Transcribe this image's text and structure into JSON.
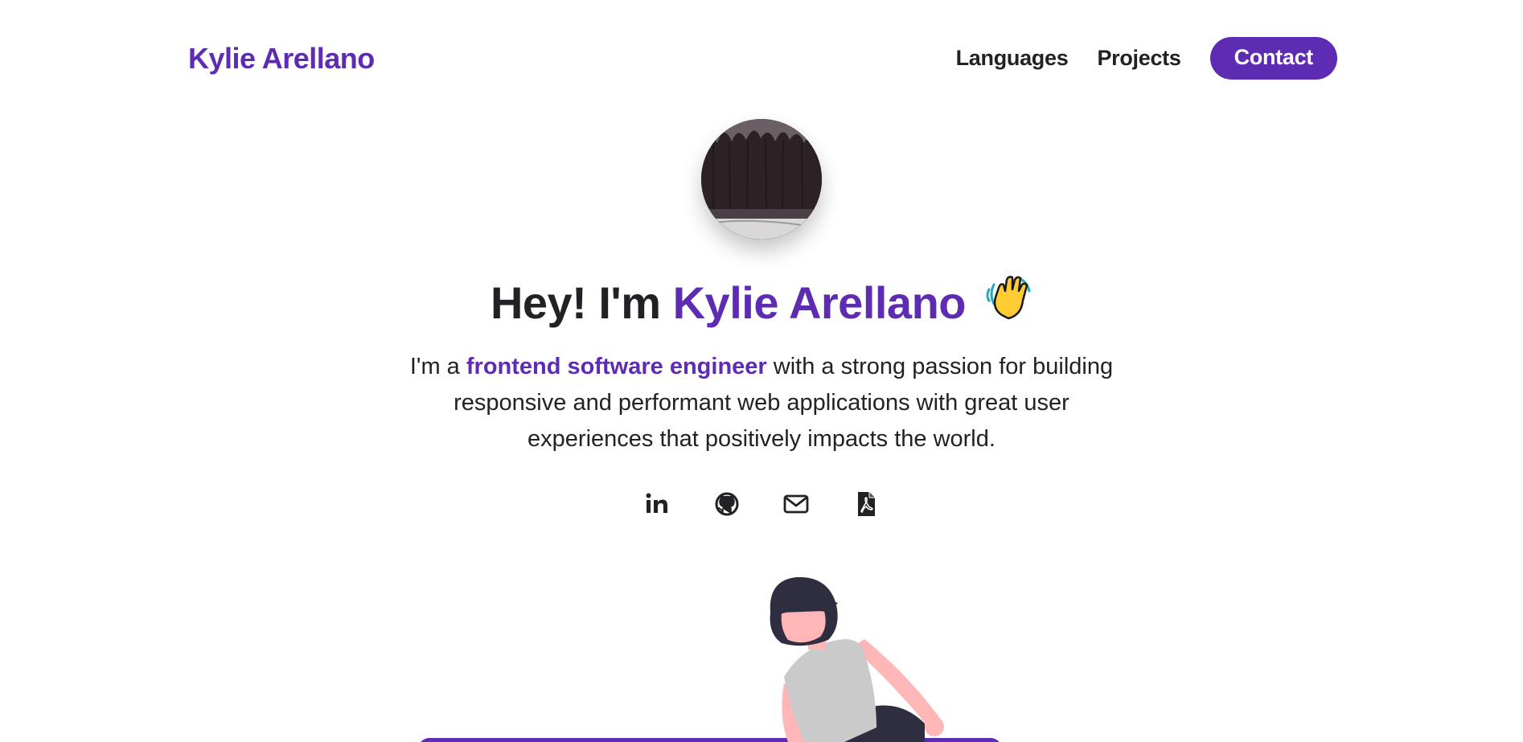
{
  "nav": {
    "brand": "Kylie Arellano",
    "links": [
      "Languages",
      "Projects"
    ],
    "contact_label": "Contact"
  },
  "hero": {
    "title_prefix": "Hey! I'm ",
    "title_name": "Kylie Arellano",
    "intro_prefix": "I'm a ",
    "intro_highlight": "frontend software engineer",
    "intro_rest": " with a strong passion for building responsive and performant web applications with great user experiences that positively impacts the world."
  },
  "social": {
    "icons": [
      "linkedin-icon",
      "github-icon",
      "email-icon",
      "pdf-resume-icon"
    ]
  },
  "colors": {
    "accent": "#5e2cb3",
    "text": "#222226",
    "background": "#ffffff"
  }
}
